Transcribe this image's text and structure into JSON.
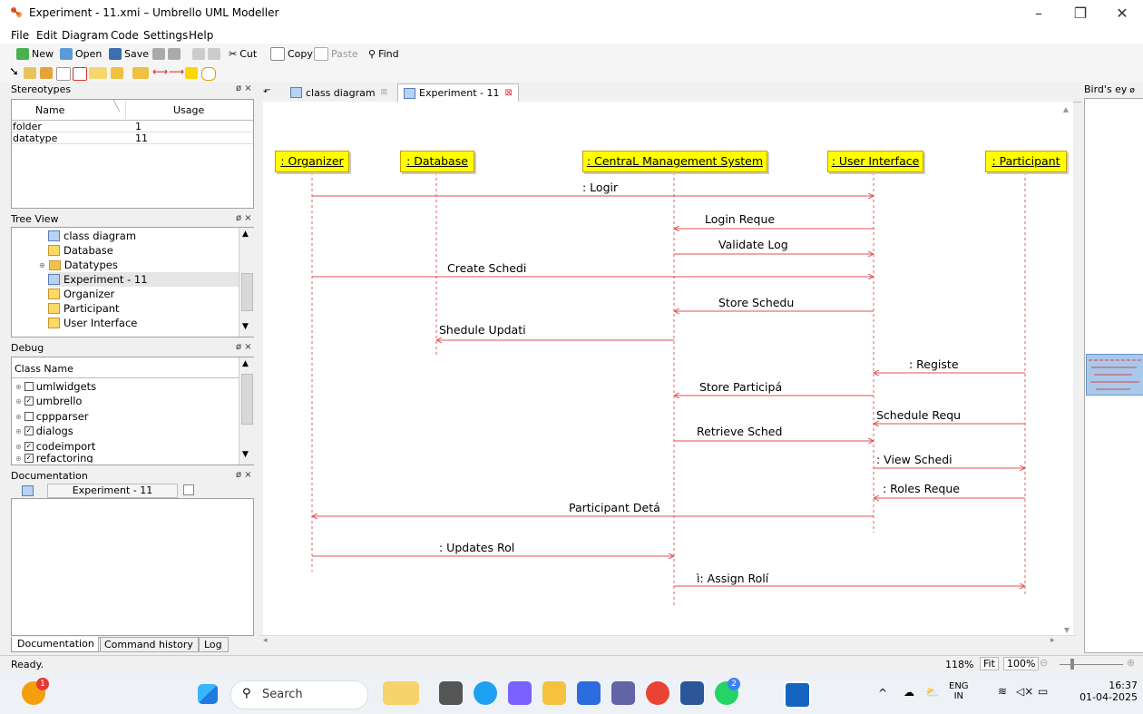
{
  "window": {
    "title": "Experiment - 11.xmi – Umbrello UML Modeller"
  },
  "menu": [
    "File",
    "Edit",
    "Diagram",
    "Code",
    "Settings",
    "Help"
  ],
  "toolbar": {
    "new": "New",
    "open": "Open",
    "save": "Save",
    "cut": "Cut",
    "copy": "Copy",
    "paste": "Paste",
    "find": "Find"
  },
  "stereotypes": {
    "title": "Stereotypes",
    "col_name": "Name",
    "col_usage": "Usage",
    "rows": [
      {
        "name": "folder",
        "usage": "1"
      },
      {
        "name": "datatype",
        "usage": "11"
      }
    ]
  },
  "treeview": {
    "title": "Tree View",
    "items": [
      "class diagram",
      "Database",
      "Datatypes",
      "Experiment - 11",
      "Organizer",
      "Participant",
      "User Interface"
    ]
  },
  "debug": {
    "title": "Debug",
    "header": "Class Name",
    "items": [
      "umlwidgets",
      "umbrello",
      "cppparser",
      "dialogs",
      "codeimport",
      "refactoring"
    ]
  },
  "documentation": {
    "title": "Documentation",
    "item": "Experiment - 11"
  },
  "bottom_tabs": [
    "Documentation",
    "Command history",
    "Log"
  ],
  "diagram_tabs": [
    "class diagram",
    "Experiment - 11"
  ],
  "birdseye": {
    "title": "Bird's ey"
  },
  "lifelines": [
    ": Organizer",
    ": Database",
    ": CentraL Management System",
    ": User Interface",
    ": Participant"
  ],
  "messages": [
    ": Logir",
    "Login Reque",
    "Validate Log",
    "Create Schedi",
    "Store Schedu",
    "Shedule Updati",
    ": Registe",
    "Store Participá",
    "Schedule Requ",
    "Retrieve Sched",
    ": View Schedi",
    ": Roles Reque",
    "Participant Detá",
    ": Updates Rol",
    "ì: Assign Rolí"
  ],
  "status": {
    "text": "Ready.",
    "zoom": "118%",
    "fit": "Fit",
    "full": "100%"
  },
  "taskbar": {
    "search": "Search",
    "lang1": "ENG",
    "lang2": "IN",
    "time": "16:37",
    "date": "01-04-2025",
    "badge1": "1",
    "badge2": "2"
  }
}
